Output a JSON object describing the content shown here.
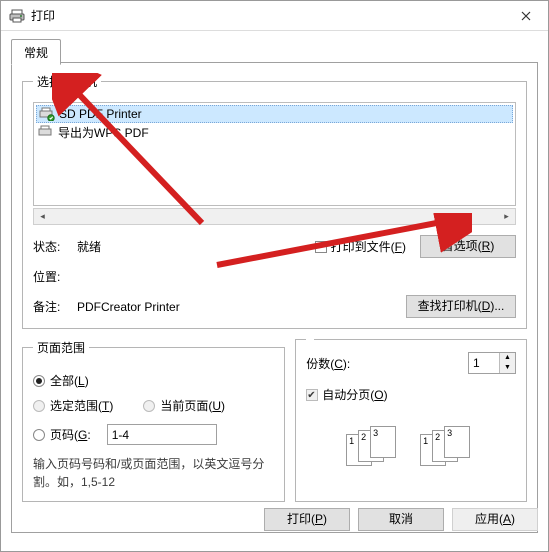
{
  "title": "打印",
  "tab_general": "常规",
  "group_select_printer": "选择打印机",
  "printers": [
    {
      "name": "SD PDF Printer",
      "selected": true,
      "default": true
    },
    {
      "name": "导出为WPS PDF",
      "selected": false,
      "default": false
    }
  ],
  "status_label": "状态:",
  "status_value": "就绪",
  "location_label": "位置:",
  "location_value": "",
  "comment_label": "备注:",
  "comment_value": "PDFCreator Printer",
  "print_to_file": {
    "label": "打印到文件(",
    "accel": "F",
    "tail": ")",
    "checked": false
  },
  "btn_preferences": {
    "label": "首选项(",
    "accel": "R",
    "tail": ")"
  },
  "btn_find_printer": {
    "label": "查找打印机(",
    "accel": "D",
    "tail": ")..."
  },
  "group_page_range": "页面范围",
  "range": {
    "all": {
      "label": "全部(",
      "accel": "L",
      "tail": ")",
      "checked": true,
      "enabled": true
    },
    "selection": {
      "label": "选定范围(",
      "accel": "T",
      "tail": ")",
      "checked": false,
      "enabled": false
    },
    "current": {
      "label": "当前页面(",
      "accel": "U",
      "tail": ")",
      "checked": false,
      "enabled": false
    },
    "pages": {
      "label": "页码(",
      "accel": "G",
      "tail": ":",
      "checked": false,
      "enabled": true
    }
  },
  "pages_value": "1-4",
  "pages_hint": "输入页码号码和/或页面范围，以英文逗号分割。如，1,5-12",
  "copies_label": {
    "label": "份数(",
    "accel": "C",
    "tail": "):"
  },
  "copies_value": "1",
  "collate": {
    "label": "自动分页(",
    "accel": "O",
    "tail": ")",
    "checked": true,
    "enabled": false
  },
  "btn_print": {
    "label": "打印(",
    "accel": "P",
    "tail": ")"
  },
  "btn_cancel": "取消",
  "btn_apply": {
    "label": "应用(",
    "accel": "A",
    "tail": ")",
    "enabled": false
  }
}
